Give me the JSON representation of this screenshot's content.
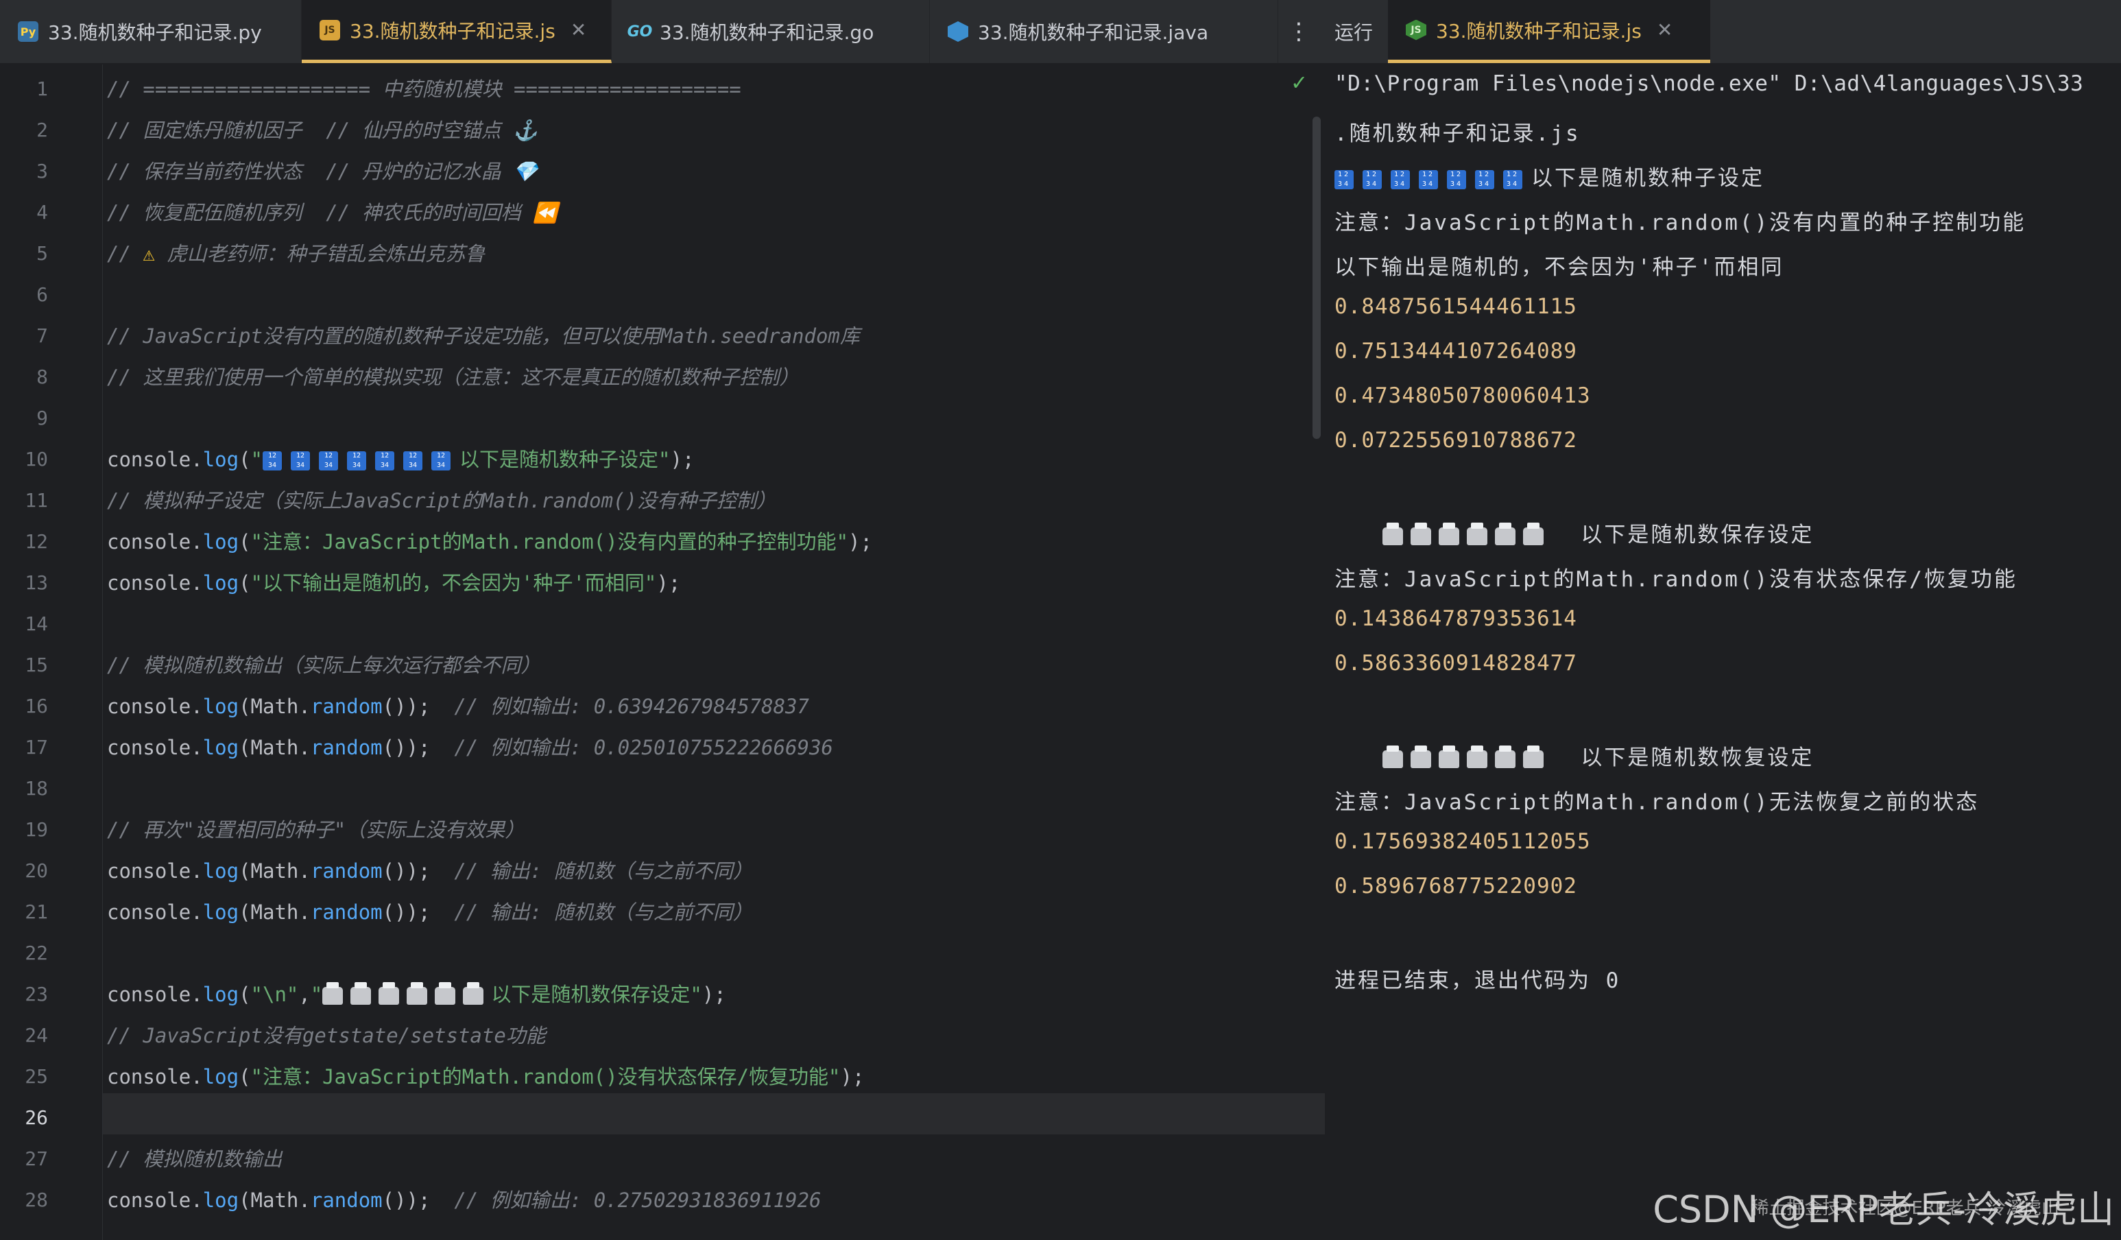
{
  "tabs": [
    {
      "label": "33.随机数种子和记录.py",
      "icon": "python-file-icon",
      "active": false
    },
    {
      "label": "33.随机数种子和记录.js",
      "icon": "javascript-file-icon",
      "active": true
    },
    {
      "label": "33.随机数种子和记录.go",
      "icon": "go-file-icon",
      "active": false
    },
    {
      "label": "33.随机数种子和记录.java",
      "icon": "java-file-icon",
      "active": false
    }
  ],
  "run_panel": {
    "label": "运行",
    "tab_label": "33.随机数种子和记录.js"
  },
  "editor": {
    "current_line": 26,
    "line_numbers": [
      "1",
      "2",
      "3",
      "4",
      "5",
      "6",
      "7",
      "8",
      "9",
      "10",
      "11",
      "12",
      "13",
      "14",
      "15",
      "16",
      "17",
      "18",
      "19",
      "20",
      "21",
      "22",
      "23",
      "24",
      "25",
      "26",
      "27",
      "28"
    ],
    "lines": {
      "l1": "// =================== 中药随机模块 ===================",
      "l2": "// 固定炼丹随机因子  // 仙丹的时空锚点 ⚓",
      "l3": "// 保存当前药性状态  // 丹炉的记忆水晶 💎",
      "l4": "// 恢复配伍随机序列  // 神农氏的时间回档 ⏪",
      "l5a": "// ",
      "l5b": "⚠ ",
      "l5c": "虎山老药师：种子错乱会炼出克苏鲁",
      "l7": "// JavaScript没有内置的随机数种子设定功能，但可以使用Math.seedrandom库",
      "l8": "// 这里我们使用一个简单的模拟实现（注意：这不是真正的随机数种子控制）",
      "l10_str": "以下是随机数种子设定",
      "l11": "// 模拟种子设定（实际上JavaScript的Math.random()没有种子控制）",
      "l12_str": "\"注意：JavaScript的Math.random()没有内置的种子控制功能\"",
      "l13_str": "\"以下输出是随机的，不会因为'种子'而相同\"",
      "l15": "// 模拟随机数输出（实际上每次运行都会不同）",
      "l16_c": "// 例如输出: 0.6394267984578837",
      "l17_c": "// 例如输出: 0.025010755222666936",
      "l19": "// 再次\"设置相同的种子\"（实际上没有效果）",
      "l20_c": "// 输出: 随机数（与之前不同）",
      "l21_c": "// 输出: 随机数（与之前不同）",
      "l23_str": "以下是随机数保存设定",
      "l24": "// JavaScript没有getstate/setstate功能",
      "l25_str": "\"注意：JavaScript的Math.random()没有状态保存/恢复功能\"",
      "l27": "// 模拟随机数输出",
      "l28_c": "// 例如输出: 0.27502931836911926"
    },
    "tokens": {
      "console": "console",
      "log": "log",
      "math": "Math",
      "random": "random",
      "newline_str": "\"\\n\""
    }
  },
  "console_output": {
    "cmd_line1": "\"D:\\Program Files\\nodejs\\node.exe\" D:\\ad\\4languages\\JS\\33",
    "cmd_line2": ".随机数种子和记录.js",
    "seed_header": "以下是随机数种子设定",
    "note1": "注意：JavaScript的Math.random()没有内置的种子控制功能",
    "note2": "以下输出是随机的，不会因为'种子'而相同",
    "nums1": [
      "0.8487561544461115",
      "0.7513444107264089",
      "0.47348050780060413",
      "0.0722556910788672"
    ],
    "save_header": "以下是随机数保存设定",
    "note3": "注意：JavaScript的Math.random()没有状态保存/恢复功能",
    "nums2": [
      "0.1438647879353614",
      "0.5863360914828477"
    ],
    "restore_header": "以下是随机数恢复设定",
    "note4": "注意：JavaScript的Math.random()无法恢复之前的状态",
    "nums3": [
      "0.17569382405112055",
      "0.5896768775220902"
    ],
    "exit": "进程已结束，退出代码为 0"
  },
  "watermark": {
    "main": "CSDN @ERP老兵-冷溪虎山",
    "sub": "稀土掘金技术社区@ERP老兵-冷溪虎山"
  }
}
